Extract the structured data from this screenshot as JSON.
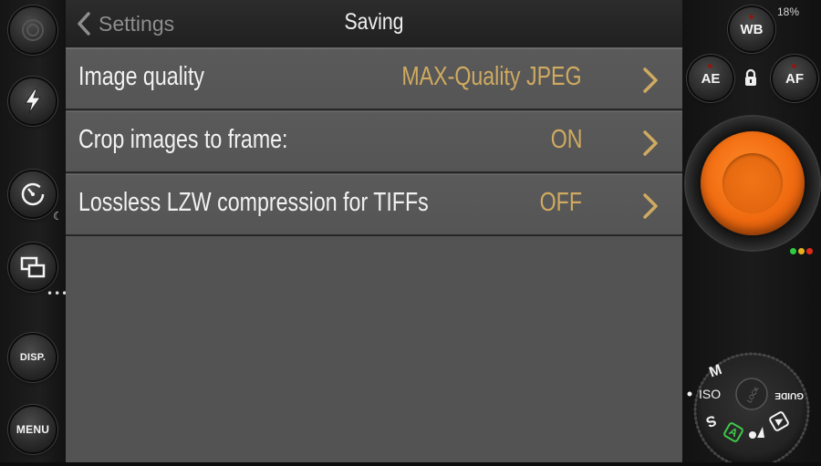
{
  "left_rail": {
    "buttons": [
      {
        "name": "camera-switch-icon"
      },
      {
        "name": "flash-icon"
      },
      {
        "name": "self-timer-icon"
      },
      {
        "name": "frame-layout-icon"
      },
      {
        "label": "DISP."
      },
      {
        "label": "MENU"
      }
    ]
  },
  "nav": {
    "back_label": "Settings",
    "title": "Saving"
  },
  "rows": [
    {
      "label": "Image quality",
      "value": "MAX-Quality JPEG"
    },
    {
      "label": "Crop images to frame:",
      "value": "ON"
    },
    {
      "label": "Lossless LZW compression for TIFFs",
      "value": "OFF"
    }
  ],
  "right_rail": {
    "battery": "18%",
    "wb_label": "WB",
    "ae_label": "AE",
    "af_label": "AF",
    "status_lights": [
      "#2ecc40",
      "#e8b020",
      "#e02a1a"
    ]
  },
  "mode_dial": {
    "labels": {
      "m": "M",
      "iso": "ISO",
      "s": "S",
      "guide": "GUIDE",
      "lock": "LOCK"
    }
  },
  "colors": {
    "value_text": "#cfaa60",
    "shutter": "#f06a0f",
    "row_bg": "#575757"
  }
}
